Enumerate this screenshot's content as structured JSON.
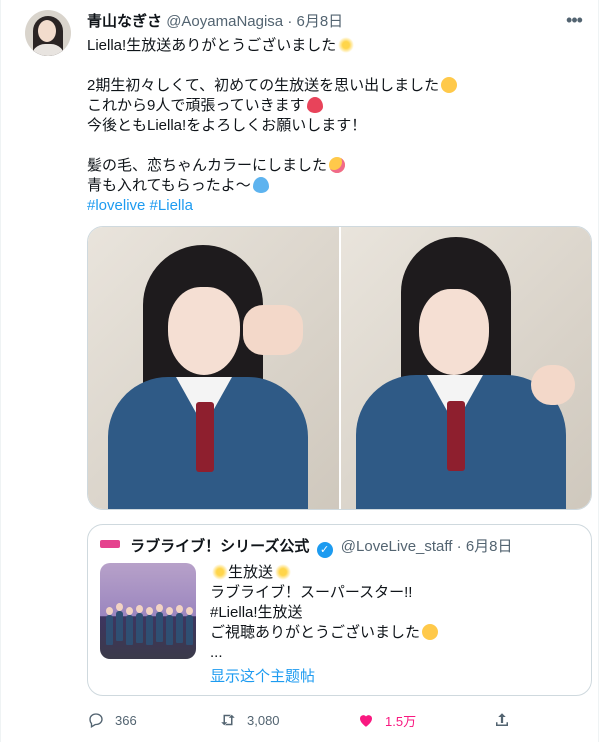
{
  "tweet": {
    "author_name": "青山なぎさ",
    "handle": "@AoyamaNagisa",
    "separator": "·",
    "date": "6月8日",
    "more_icon": "more-horizontal-icon",
    "lines": [
      "Liella!生放送ありがとうございました",
      "",
      "2期生初々しくて、初めての生放送を思い出しました",
      "これから9人で頑張っていきます",
      "今後ともLiella!をよろしくお願いします！",
      "",
      "髪の毛、恋ちゃんカラーにしました",
      "青も入れてもらったよ〜"
    ],
    "hashtags": [
      "#lovelive",
      "#Liella"
    ],
    "photos_count": 2
  },
  "quote": {
    "author_name": "ラブライブ！シリーズ公式",
    "handle": "@LoveLive_staff",
    "separator": "·",
    "date": "6月8日",
    "verified_icon": "verified-badge-icon",
    "lines": [
      "生放送",
      "ラブライブ！スーパースター!!",
      "#Liella!生放送",
      "ご視聴ありがとうございました",
      "..."
    ],
    "show_thread": "显示这个主题帖"
  },
  "actions": {
    "reply_count": "366",
    "retweet_count": "3,080",
    "like_count": "1.5万",
    "colors": {
      "like": "#f91880",
      "muted": "#536471",
      "link": "#1d9bf0"
    }
  }
}
